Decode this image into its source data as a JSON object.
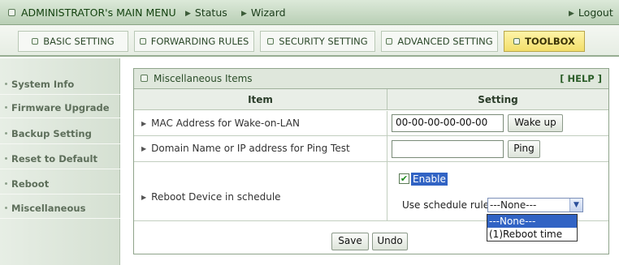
{
  "topbar": {
    "admin_menu": "ADMINISTRATOR's MAIN MENU",
    "status": "Status",
    "wizard": "Wizard",
    "logout": "Logout"
  },
  "tabs": [
    {
      "label": "BASIC SETTING"
    },
    {
      "label": "FORWARDING RULES"
    },
    {
      "label": "SECURITY SETTING"
    },
    {
      "label": "ADVANCED SETTING"
    },
    {
      "label": "TOOLBOX",
      "active": true
    }
  ],
  "sidebar": {
    "items": [
      {
        "label": "System Info"
      },
      {
        "label": "Firmware Upgrade"
      },
      {
        "label": "Backup Setting"
      },
      {
        "label": "Reset to Default"
      },
      {
        "label": "Reboot"
      },
      {
        "label": "Miscellaneous"
      }
    ]
  },
  "panel": {
    "title": "Miscellaneous Items",
    "help": "[ HELP ]",
    "col_item": "Item",
    "col_setting": "Setting",
    "rows": [
      {
        "label": "MAC Address for Wake-on-LAN",
        "value": "00-00-00-00-00-00",
        "button": "Wake up"
      },
      {
        "label": "Domain Name or IP address for Ping Test",
        "value": "",
        "button": "Ping"
      },
      {
        "label": "Reboot Device in schedule",
        "enable_label": "Enable",
        "enable_checked": true,
        "schedule_label": "Use schedule rule",
        "schedule_selected": "---None---",
        "schedule_options": [
          "---None---",
          "(1)Reboot time"
        ]
      }
    ],
    "save": "Save",
    "undo": "Undo"
  },
  "colors": {
    "accent_tab": "#f2de6a",
    "selection": "#3163c4"
  }
}
